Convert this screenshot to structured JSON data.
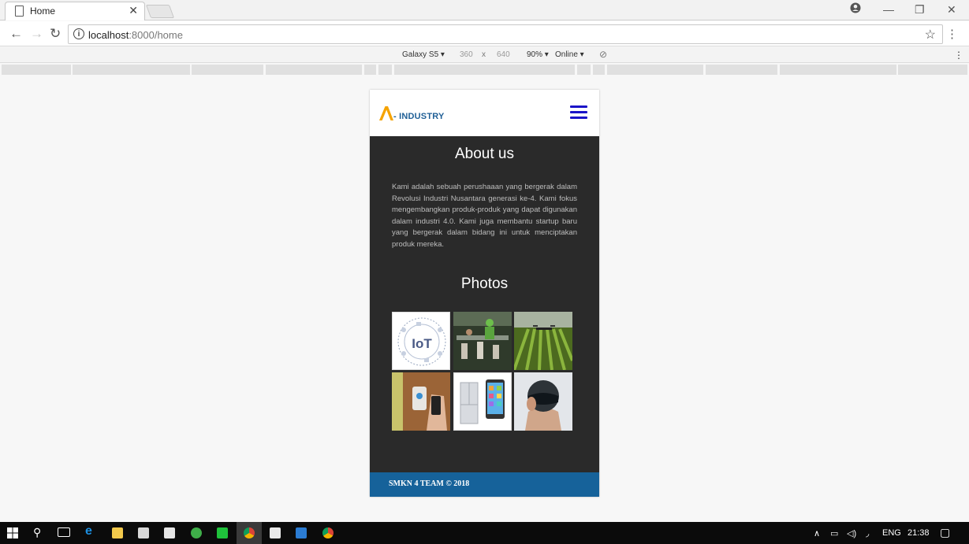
{
  "browser": {
    "tab_title": "Home",
    "tab_close": "✕",
    "url_host": "localhost",
    "url_path": ":8000/home",
    "window_controls": [
      "—",
      "❐",
      "✕"
    ]
  },
  "devtools": {
    "device": "Galaxy S5 ▾",
    "width": "360",
    "times": "x",
    "height": "640",
    "zoom": "90% ▾",
    "network": "Online ▾"
  },
  "site": {
    "logo_text": "- INDUSTRY",
    "about_title": "About us",
    "about_text": "Kami adalah sebuah perushaaan yang bergerak dalam Revolusi Industri Nusantara generasi ke-4. Kami fokus mengembangkan produk-produk yang dapat digunakan dalam industri 4.0. Kami juga membantu startup baru yang bergerak dalam bidang ini untuk menciptakan produk mereka.",
    "photos_title": "Photos",
    "photos": [
      "IoT icons",
      "factory workers",
      "drone over field",
      "smart home phone",
      "smart fridge and phone",
      "smart helmet"
    ],
    "iot_label": "IoT",
    "footer_text": "SMKN 4 TEAM © 2018"
  },
  "taskbar": {
    "lang": "ENG",
    "time": "21:38"
  },
  "colors": {
    "footer": "#16629a",
    "body_bg": "#2a2a2a",
    "accent_logo": "#f5a300",
    "hamburger": "#1b14c8"
  }
}
